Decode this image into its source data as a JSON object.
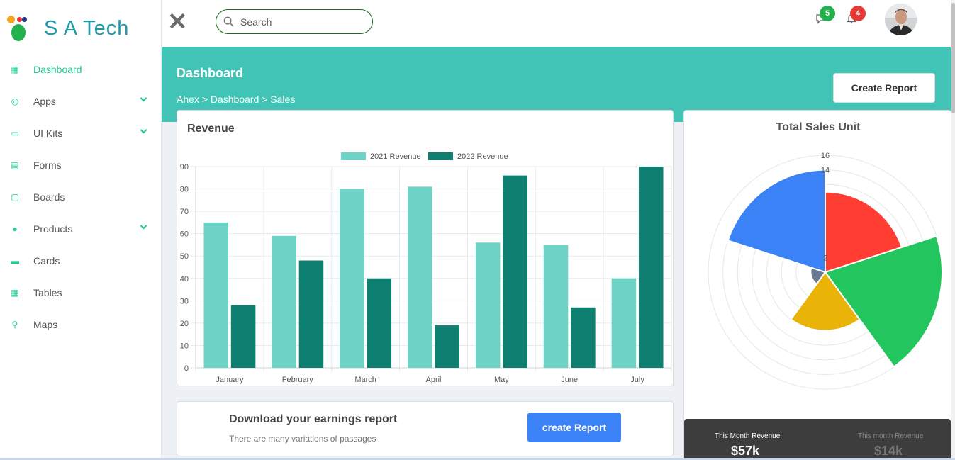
{
  "brand": {
    "name": "S A Tech"
  },
  "sidebar": {
    "items": [
      {
        "label": "Dashboard",
        "icon": "grid-icon",
        "active": true,
        "expandable": false
      },
      {
        "label": "Apps",
        "icon": "apps-icon",
        "active": false,
        "expandable": true
      },
      {
        "label": "UI Kits",
        "icon": "ui-kits-icon",
        "active": false,
        "expandable": true
      },
      {
        "label": "Forms",
        "icon": "forms-icon",
        "active": false,
        "expandable": false
      },
      {
        "label": "Boards",
        "icon": "boards-icon",
        "active": false,
        "expandable": false
      },
      {
        "label": "Products",
        "icon": "products-icon",
        "active": false,
        "expandable": true
      },
      {
        "label": "Cards",
        "icon": "cards-icon",
        "active": false,
        "expandable": false
      },
      {
        "label": "Tables",
        "icon": "tables-icon",
        "active": false,
        "expandable": false
      },
      {
        "label": "Maps",
        "icon": "maps-icon",
        "active": false,
        "expandable": false
      }
    ]
  },
  "topbar": {
    "search_placeholder": "Search",
    "messages_count": "5",
    "notifications_count": "4"
  },
  "header": {
    "title": "Dashboard",
    "breadcrumb": "Ahex > Dashboard > Sales",
    "create_report_label": "Create Report"
  },
  "revenue": {
    "title": "Revenue",
    "chart_data": {
      "type": "bar",
      "categories": [
        "January",
        "February",
        "March",
        "April",
        "May",
        "June",
        "July"
      ],
      "series": [
        {
          "name": "2021 Revenue",
          "color": "#6dd3c7",
          "values": [
            65,
            59,
            80,
            81,
            56,
            55,
            40
          ]
        },
        {
          "name": "2022 Revenue",
          "color": "#0f7f72",
          "values": [
            28,
            48,
            40,
            19,
            86,
            27,
            90
          ]
        }
      ],
      "ylim": [
        0,
        90
      ],
      "yticks": [
        0,
        10,
        20,
        30,
        40,
        50,
        60,
        70,
        80,
        90
      ],
      "grid": true,
      "legend": "top-center"
    }
  },
  "sales": {
    "title": "Total Sales Unit",
    "chart_data": {
      "type": "polar-area",
      "values": [
        11,
        16,
        8,
        2,
        14
      ],
      "colors": [
        "#ff3d33",
        "#22c55e",
        "#eab308",
        "#6b7a90",
        "#3b82f6"
      ],
      "rlim": [
        0,
        16
      ],
      "rticks": [
        "2",
        "14",
        "16"
      ],
      "grid": true
    }
  },
  "earnings": {
    "title": "Download your earnings report",
    "subtitle": "There are many variations of passages",
    "button_label": "create Report"
  },
  "stats": [
    {
      "label": "This Month Revenue",
      "value": "$57k"
    },
    {
      "label": "This month Revenue",
      "value": "$14k"
    }
  ]
}
